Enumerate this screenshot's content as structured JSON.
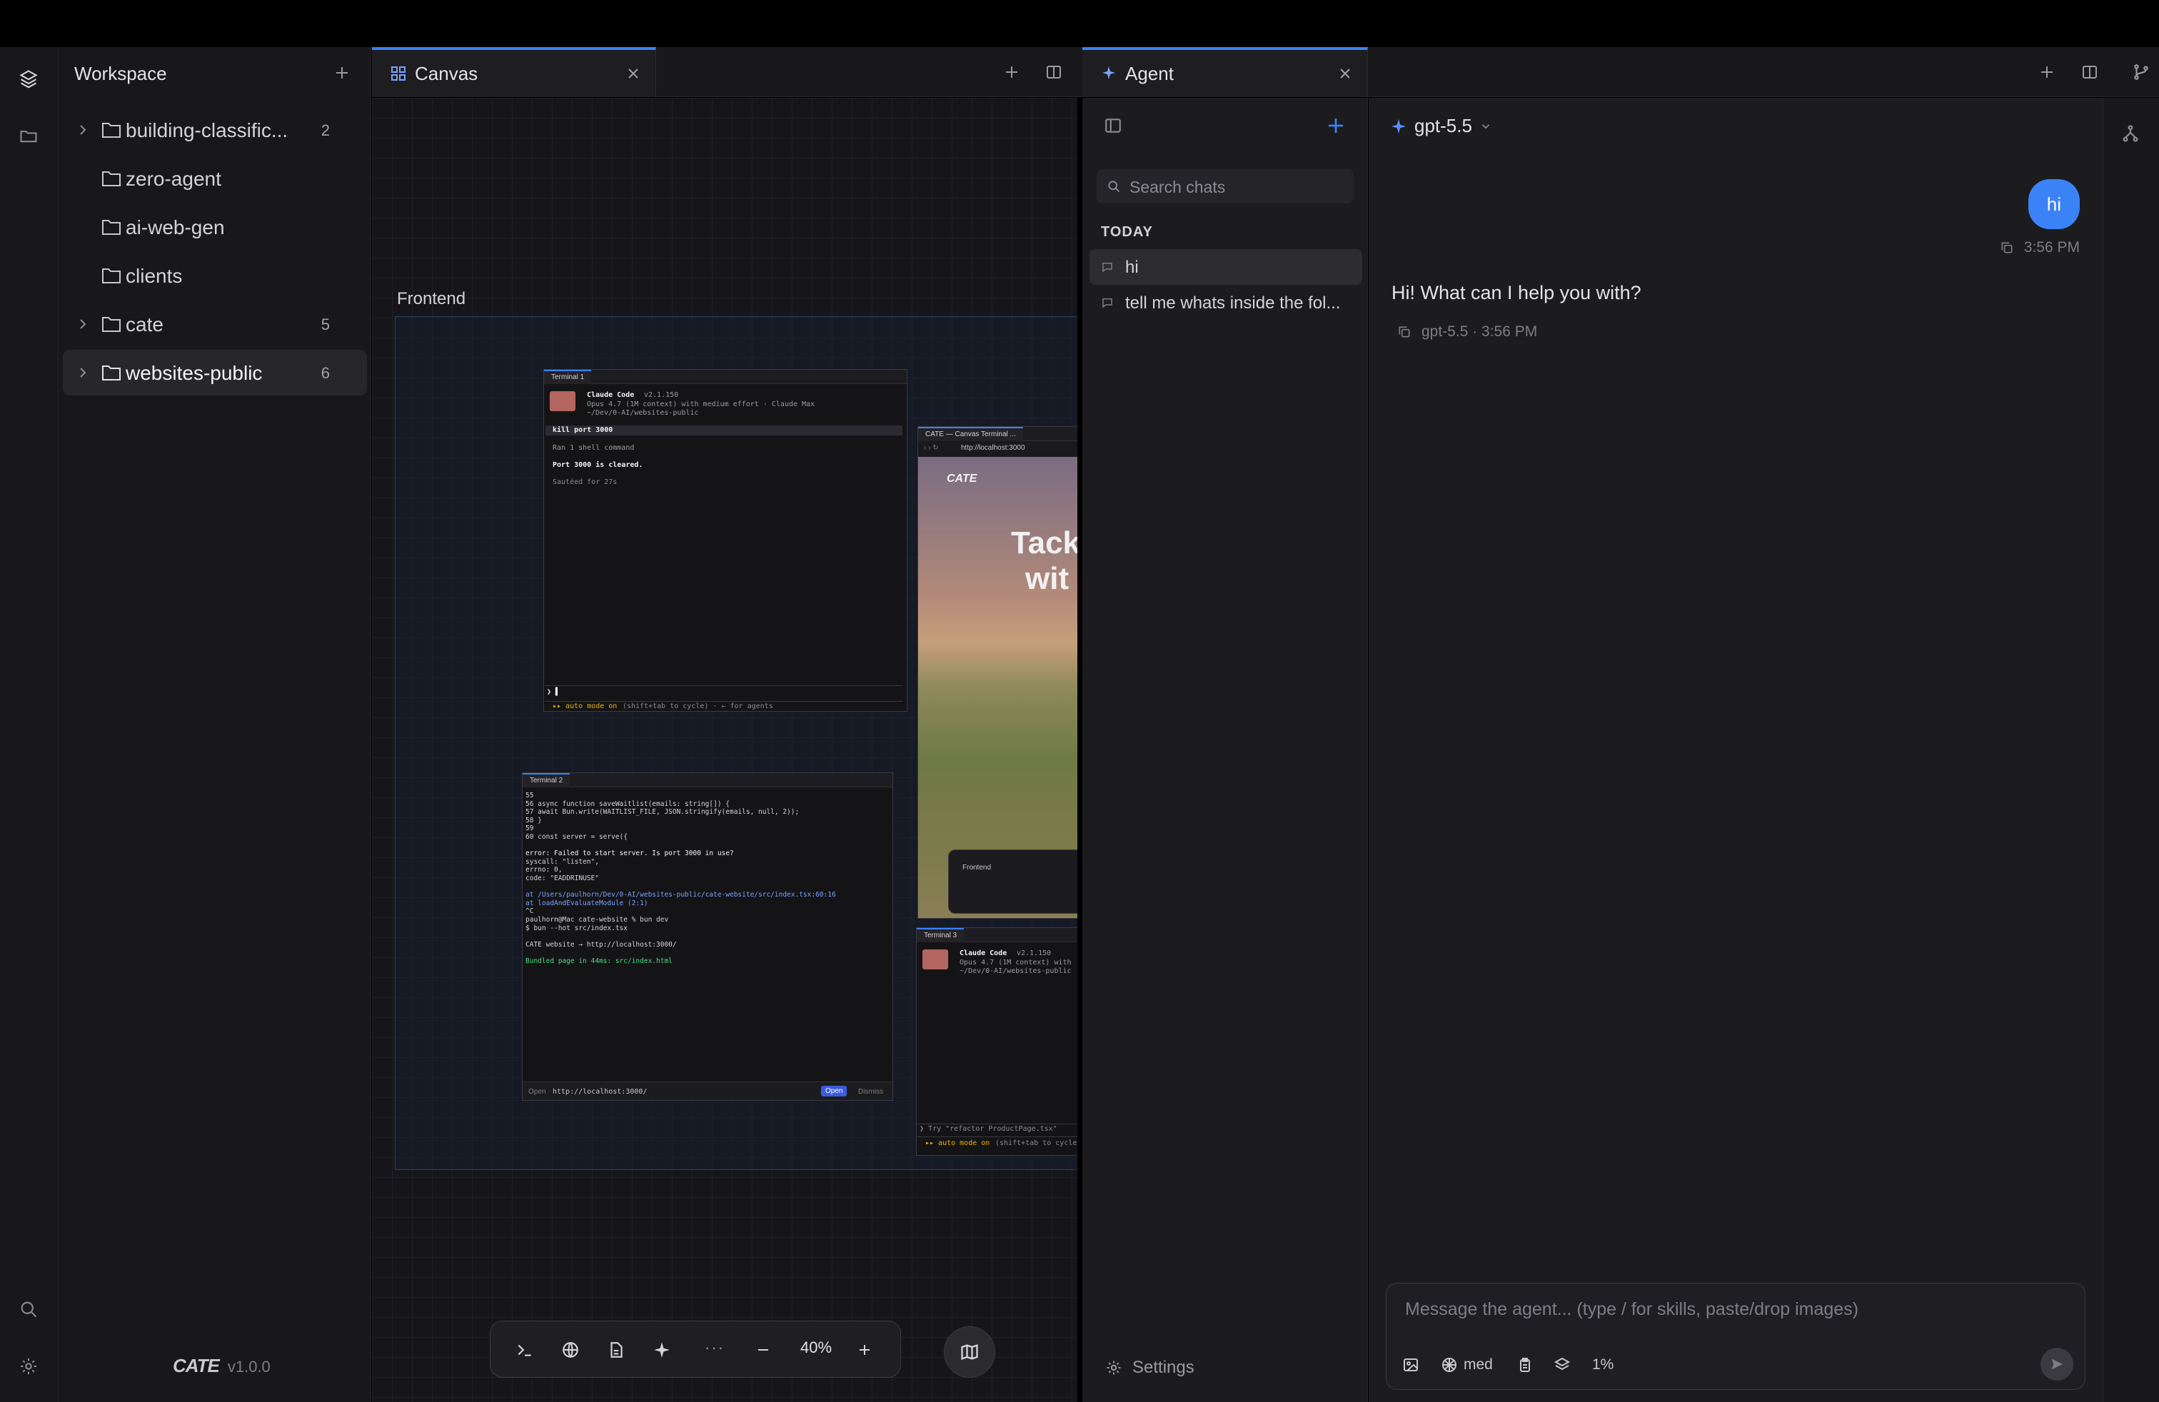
{
  "sidebar": {
    "title": "Workspace",
    "items": [
      {
        "label": "building-classific...",
        "count": "2",
        "expandable": true
      },
      {
        "label": "zero-agent",
        "count": "",
        "expandable": false
      },
      {
        "label": "ai-web-gen",
        "count": "",
        "expandable": false
      },
      {
        "label": "clients",
        "count": "",
        "expandable": false
      },
      {
        "label": "cate",
        "count": "5",
        "expandable": true
      },
      {
        "label": "websites-public",
        "count": "6",
        "expandable": true,
        "selected": true
      }
    ],
    "brand": "CATE",
    "version": "v1.0.0"
  },
  "tabs": {
    "canvas": {
      "label": "Canvas"
    },
    "agent": {
      "label": "Agent"
    }
  },
  "canvas": {
    "group_label": "Frontend",
    "zoom": "40%",
    "dock_more": "···",
    "terminal1": {
      "tab": "Terminal 1",
      "app": "Claude Code",
      "version": "v2.1.150",
      "model_line": "Opus 4.7 (1M context) with medium effort · Claude Max",
      "path": "~/Dev/0-AI/websites-public",
      "cmd": "kill port 3000",
      "ran": "Ran 1 shell command",
      "result": "Port 3000 is cleared.",
      "sauteed": "Sautéed for 27s",
      "auto_mode": "▸▸ auto mode on",
      "auto_hint": "(shift+tab to cycle) · ← for agents"
    },
    "browser": {
      "tab": "CATE — Canvas Terminal ...",
      "url": "http://localhost:3000",
      "logo": "CATE",
      "hero1": "Tack",
      "hero2": "wit",
      "inner_label": "Frontend"
    },
    "terminal2": {
      "tab": "Terminal 2",
      "lines": [
        "55",
        "56    async function saveWaitlist(emails: string[]) {",
        "57      await Bun.write(WAITLIST_FILE, JSON.stringify(emails, null, 2));",
        "58    }",
        "59",
        "60    const server = serve({",
        "",
        "error: Failed to start server. Is port 3000 in use?",
        " syscall: \"listen\",",
        "   errno: 0,",
        "    code: \"EADDRINUSE\"",
        "",
        "      at /Users/paulhorn/Dev/0-AI/websites-public/cate-website/src/index.tsx:60:16",
        "      at loadAndEvaluateModule (2:1)",
        "^C",
        "paulhorn@Mac cate-website % bun dev",
        "$ bun --hot src/index.tsx",
        "",
        "  CATE website → http://localhost:3000/",
        "",
        "Bundled page in 44ms: src/index.html"
      ],
      "footer_open": "Open",
      "footer_url": "http://localhost:3000/",
      "footer_btn": "Open",
      "footer_dismiss": "Dismiss"
    },
    "terminal3": {
      "tab": "Terminal 3",
      "app": "Claude Code",
      "version": "v2.1.150",
      "model_line": "Opus 4.7 (1M context) with",
      "path": "~/Dev/0-AI/websites-public",
      "prompt": "Try \"refactor ProductPage.tsx\"",
      "auto_mode": "▸▸ auto mode on",
      "auto_hint": "(shift+tab to cycle"
    }
  },
  "agent": {
    "search_placeholder": "Search chats",
    "section": "TODAY",
    "chats": [
      {
        "title": "hi",
        "active": true
      },
      {
        "title": "tell me whats inside the fol...",
        "active": false
      }
    ],
    "settings": "Settings",
    "model": "gpt-5.5",
    "messages": {
      "user_text": "hi",
      "user_time": "3:56 PM",
      "assistant_text": "Hi! What can I help you with?",
      "assistant_meta": "gpt-5.5 · 3:56 PM"
    },
    "composer": {
      "placeholder": "Message the agent...  (type / for skills, paste/drop images)",
      "effort": "med",
      "context": "1%"
    }
  },
  "colors": {
    "accent": "#3b82f6",
    "background": "#1c1c1f",
    "sidebar": "#18181b"
  },
  "icons": [
    "layers-icon",
    "folder-icon",
    "search-icon",
    "gear-icon",
    "plus-icon",
    "grid-icon",
    "close-icon",
    "split-icon",
    "sparkle-icon",
    "git-branch-icon",
    "terminal-icon",
    "globe-icon",
    "document-icon",
    "minus-icon",
    "map-icon",
    "send-icon"
  ]
}
